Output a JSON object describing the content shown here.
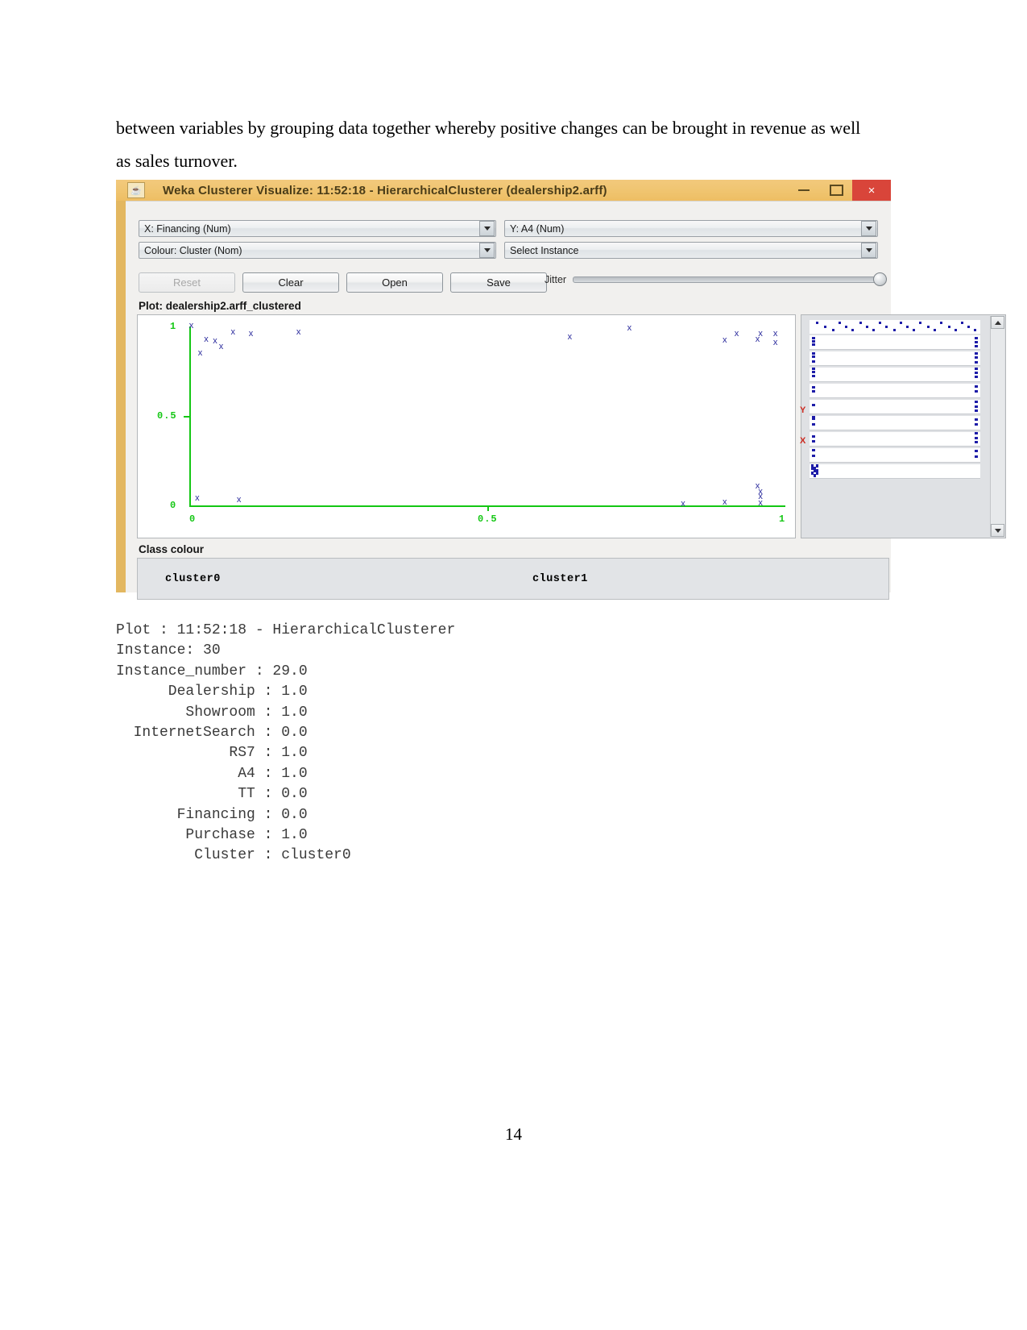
{
  "document": {
    "paragraph": "between variables by grouping data together whereby positive changes can be brought in revenue as well as sales turnover.",
    "page_number": "14"
  },
  "window": {
    "title": "Weka Clusterer Visualize: 11:52:18 - HierarchicalClusterer (dealership2.arff)",
    "app_icon": "weka-coffee-icon",
    "controls": {
      "minimize": "minimize-icon",
      "maximize": "maximize-icon",
      "close": "×"
    },
    "titlebar_color": "#f0c571",
    "close_color": "#d9453a"
  },
  "toolbar": {
    "x_select": "X: Financing (Num)",
    "y_select": "Y: A4 (Num)",
    "colour_select": "Colour: Cluster (Nom)",
    "instance_select": "Select Instance",
    "reset_label": "Reset",
    "clear_label": "Clear",
    "open_label": "Open",
    "save_label": "Save",
    "jitter_label": "Jitter"
  },
  "plot": {
    "caption": "Plot: dealership2.arff_clustered",
    "class_colour_label": "Class colour",
    "legend": [
      {
        "label": "cluster0",
        "color": "#2a2a9c"
      },
      {
        "label": "cluster1",
        "color": "#cc2020"
      }
    ],
    "axis_color": "#14c714"
  },
  "chart_data": {
    "type": "scatter",
    "title": "Plot: dealership2.arff_clustered",
    "xlabel": "X: Financing (Num)",
    "ylabel": "Y: A4 (Num)",
    "xlim": [
      0,
      1
    ],
    "ylim": [
      0,
      1
    ],
    "xticks": [
      "0",
      "0.5",
      "1"
    ],
    "yticks": [
      "0",
      "0.5",
      "1"
    ],
    "grid": false,
    "legend_position": "bottom",
    "point_marker": "x",
    "series": [
      {
        "name": "cluster0",
        "color": "#2a2a9c",
        "points": [
          [
            0.005,
            1.0
          ],
          [
            0.075,
            0.965
          ],
          [
            0.105,
            0.955
          ],
          [
            0.185,
            0.965
          ],
          [
            0.03,
            0.925
          ],
          [
            0.045,
            0.915
          ],
          [
            0.055,
            0.885
          ],
          [
            0.02,
            0.845
          ],
          [
            0.74,
            0.985
          ],
          [
            0.92,
            0.955
          ],
          [
            0.96,
            0.955
          ],
          [
            0.985,
            0.955
          ],
          [
            0.64,
            0.935
          ],
          [
            0.9,
            0.92
          ],
          [
            0.955,
            0.925
          ],
          [
            0.985,
            0.905
          ],
          [
            0.015,
            0.035
          ],
          [
            0.085,
            0.025
          ],
          [
            0.955,
            0.105
          ],
          [
            0.96,
            0.07
          ],
          [
            0.96,
            0.045
          ],
          [
            0.9,
            0.015
          ],
          [
            0.83,
            0.005
          ],
          [
            0.96,
            0.01
          ]
        ]
      },
      {
        "name": "cluster1",
        "color": "#cc2020",
        "points": []
      }
    ]
  },
  "side_panel": {
    "y_marker": "Y",
    "x_marker": "X",
    "scroll_up": "scroll-up-arrow",
    "scroll_down": "scroll-down-arrow"
  },
  "console": {
    "lines": [
      "Plot : 11:52:18 - HierarchicalClusterer",
      "Instance: 30",
      "Instance_number : 29.0",
      "      Dealership : 1.0",
      "        Showroom : 1.0",
      "  InternetSearch : 0.0",
      "             RS7 : 1.0",
      "              A4 : 1.0",
      "              TT : 0.0",
      "       Financing : 0.0",
      "        Purchase : 1.0",
      "         Cluster : cluster0"
    ],
    "text": "Plot : 11:52:18 - HierarchicalClusterer\nInstance: 30\nInstance_number : 29.0\n      Dealership : 1.0\n        Showroom : 1.0\n  InternetSearch : 0.0\n             RS7 : 1.0\n              A4 : 1.0\n              TT : 0.0\n       Financing : 0.0\n        Purchase : 1.0\n         Cluster : cluster0"
  }
}
